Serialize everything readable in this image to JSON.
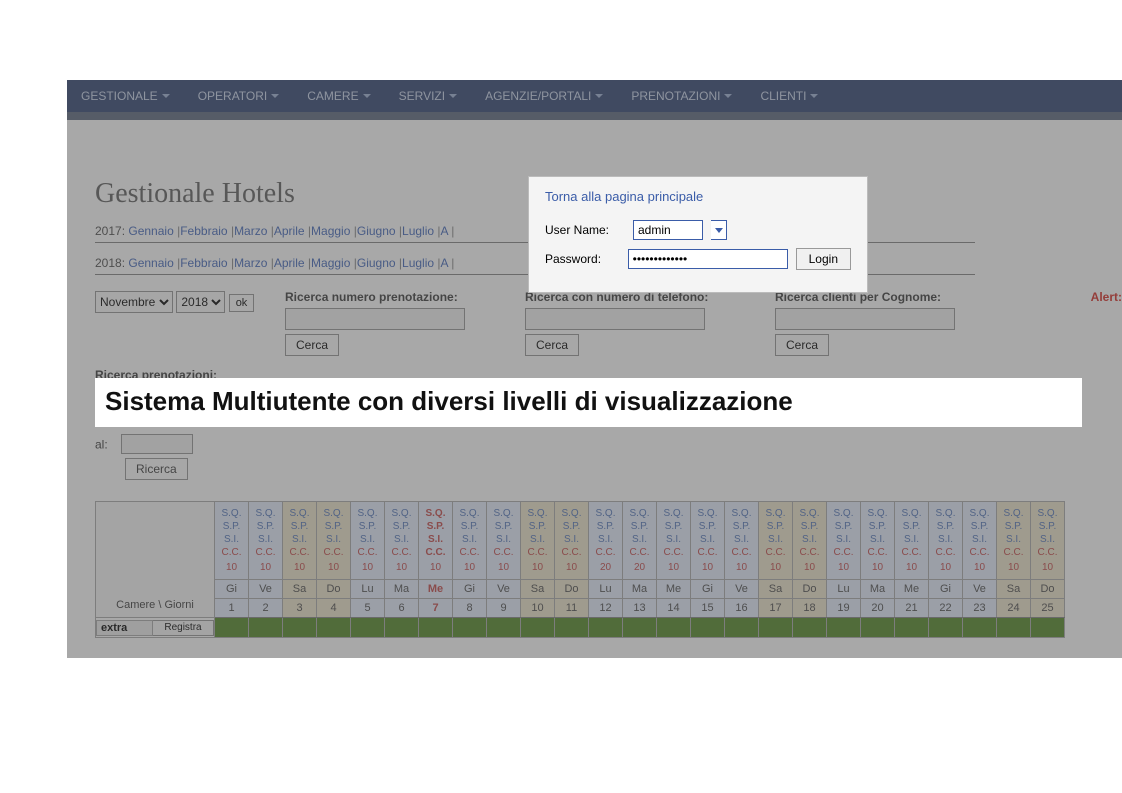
{
  "nav": {
    "items": [
      "GESTIONALE",
      "OPERATORI",
      "CAMERE",
      "SERVIZI",
      "AGENZIE/PORTALI",
      "PRENOTAZIONI",
      "CLIENTI"
    ]
  },
  "page_title": "Gestionale Hotels",
  "years": {
    "y2017": {
      "year": "2017",
      "months": [
        "Gennaio",
        "Febbraio",
        "Marzo",
        "Aprile",
        "Maggio",
        "Giugno",
        "Luglio",
        "A"
      ]
    },
    "y2018": {
      "year": "2018",
      "months": [
        "Gennaio",
        "Febbraio",
        "Marzo",
        "Aprile",
        "Maggio",
        "Giugno",
        "Luglio",
        "A"
      ]
    }
  },
  "filters": {
    "month_value": "Novembre",
    "year_value": "2018",
    "ok": "ok",
    "search1_label": "Ricerca numero prenotazione:",
    "search2_label": "Ricerca con numero di telefono:",
    "search3_label": "Ricerca clienti per Cognome:",
    "cerca": "Cerca",
    "alert": "Alert:",
    "ricerca_pren": "Ricerca prenotazioni:",
    "al": "al:",
    "ricerca": "Ricerca"
  },
  "banner": "Sistema Multiutente con diversi livelli di visualizzazione",
  "login": {
    "back_link": "Torna alla pagina principale",
    "username_label": "User Name:",
    "username_value": "admin",
    "password_label": "Password:",
    "password_value": "•••••••••••••",
    "login_btn": "Login"
  },
  "calendar": {
    "rooms_label": "Camere \\ Giorni",
    "links": [
      "S.Q.",
      "S.P.",
      "S.I.",
      "C.C."
    ],
    "count_default": "10",
    "count_20": "20",
    "extra": "extra",
    "registra": "Registra",
    "days": [
      {
        "wd": "Gi",
        "num": "1",
        "weekend": false,
        "today": false
      },
      {
        "wd": "Ve",
        "num": "2",
        "weekend": false,
        "today": false
      },
      {
        "wd": "Sa",
        "num": "3",
        "weekend": true,
        "today": false
      },
      {
        "wd": "Do",
        "num": "4",
        "weekend": true,
        "today": false
      },
      {
        "wd": "Lu",
        "num": "5",
        "weekend": false,
        "today": false
      },
      {
        "wd": "Ma",
        "num": "6",
        "weekend": false,
        "today": false
      },
      {
        "wd": "Me",
        "num": "7",
        "weekend": false,
        "today": true
      },
      {
        "wd": "Gi",
        "num": "8",
        "weekend": false,
        "today": false
      },
      {
        "wd": "Ve",
        "num": "9",
        "weekend": false,
        "today": false
      },
      {
        "wd": "Sa",
        "num": "10",
        "weekend": true,
        "today": false
      },
      {
        "wd": "Do",
        "num": "11",
        "weekend": true,
        "today": false
      },
      {
        "wd": "Lu",
        "num": "12",
        "weekend": false,
        "today": false,
        "count": "20"
      },
      {
        "wd": "Ma",
        "num": "13",
        "weekend": false,
        "today": false,
        "count": "20"
      },
      {
        "wd": "Me",
        "num": "14",
        "weekend": false,
        "today": false
      },
      {
        "wd": "Gi",
        "num": "15",
        "weekend": false,
        "today": false
      },
      {
        "wd": "Ve",
        "num": "16",
        "weekend": false,
        "today": false
      },
      {
        "wd": "Sa",
        "num": "17",
        "weekend": true,
        "today": false
      },
      {
        "wd": "Do",
        "num": "18",
        "weekend": true,
        "today": false
      },
      {
        "wd": "Lu",
        "num": "19",
        "weekend": false,
        "today": false
      },
      {
        "wd": "Ma",
        "num": "20",
        "weekend": false,
        "today": false
      },
      {
        "wd": "Me",
        "num": "21",
        "weekend": false,
        "today": false
      },
      {
        "wd": "Gi",
        "num": "22",
        "weekend": false,
        "today": false
      },
      {
        "wd": "Ve",
        "num": "23",
        "weekend": false,
        "today": false
      },
      {
        "wd": "Sa",
        "num": "24",
        "weekend": true,
        "today": false
      },
      {
        "wd": "Do",
        "num": "25",
        "weekend": true,
        "today": false
      }
    ]
  }
}
